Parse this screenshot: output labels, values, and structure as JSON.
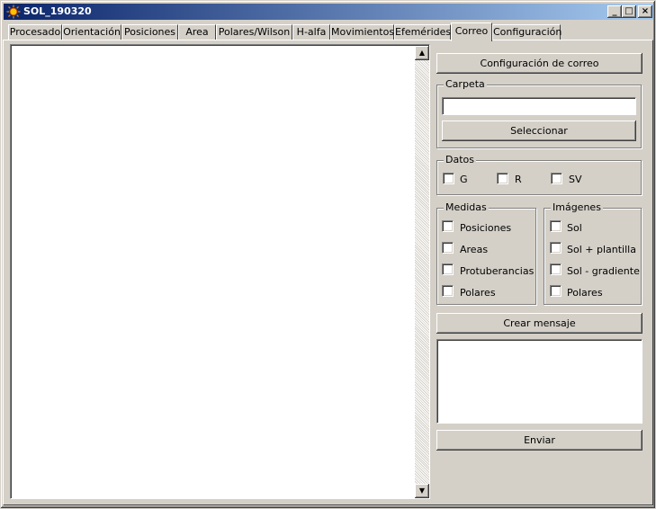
{
  "window": {
    "title": "SOL_190320",
    "minimize_glyph": "_",
    "maximize_glyph": "□",
    "close_glyph": "×"
  },
  "tabs": [
    {
      "label": "Procesado"
    },
    {
      "label": "Orientación"
    },
    {
      "label": "Posiciones"
    },
    {
      "label": "Area"
    },
    {
      "label": "Polares/Wilson"
    },
    {
      "label": "H-alfa"
    },
    {
      "label": "Movimientos"
    },
    {
      "label": "Efemérides"
    },
    {
      "label": "Correo",
      "active": true
    },
    {
      "label": "Configuración"
    }
  ],
  "scrollbar": {
    "up_glyph": "▲",
    "down_glyph": "▼"
  },
  "email_config_button": "Configuración de correo",
  "carpeta": {
    "title": "Carpeta",
    "path_value": "",
    "select_button": "Seleccionar"
  },
  "datos": {
    "title": "Datos",
    "options": [
      {
        "label": "G",
        "checked": false
      },
      {
        "label": "R",
        "checked": false
      },
      {
        "label": "SV",
        "checked": false
      }
    ]
  },
  "medidas": {
    "title": "Medidas",
    "options": [
      {
        "label": "Posiciones",
        "checked": false
      },
      {
        "label": "Areas",
        "checked": false
      },
      {
        "label": "Protuberancias",
        "checked": false
      },
      {
        "label": "Polares",
        "checked": false
      }
    ]
  },
  "imagenes": {
    "title": "Imágenes",
    "options": [
      {
        "label": "Sol",
        "checked": false
      },
      {
        "label": "Sol + plantilla",
        "checked": false
      },
      {
        "label": "Sol - gradiente",
        "checked": false
      },
      {
        "label": "Polares",
        "checked": false
      }
    ]
  },
  "create_message_button": "Crear mensaje",
  "message_preview": "",
  "send_button": "Enviar",
  "colors": {
    "titlebar_start": "#0a246a",
    "titlebar_end": "#a6caf0",
    "face": "#d4d0c8"
  }
}
